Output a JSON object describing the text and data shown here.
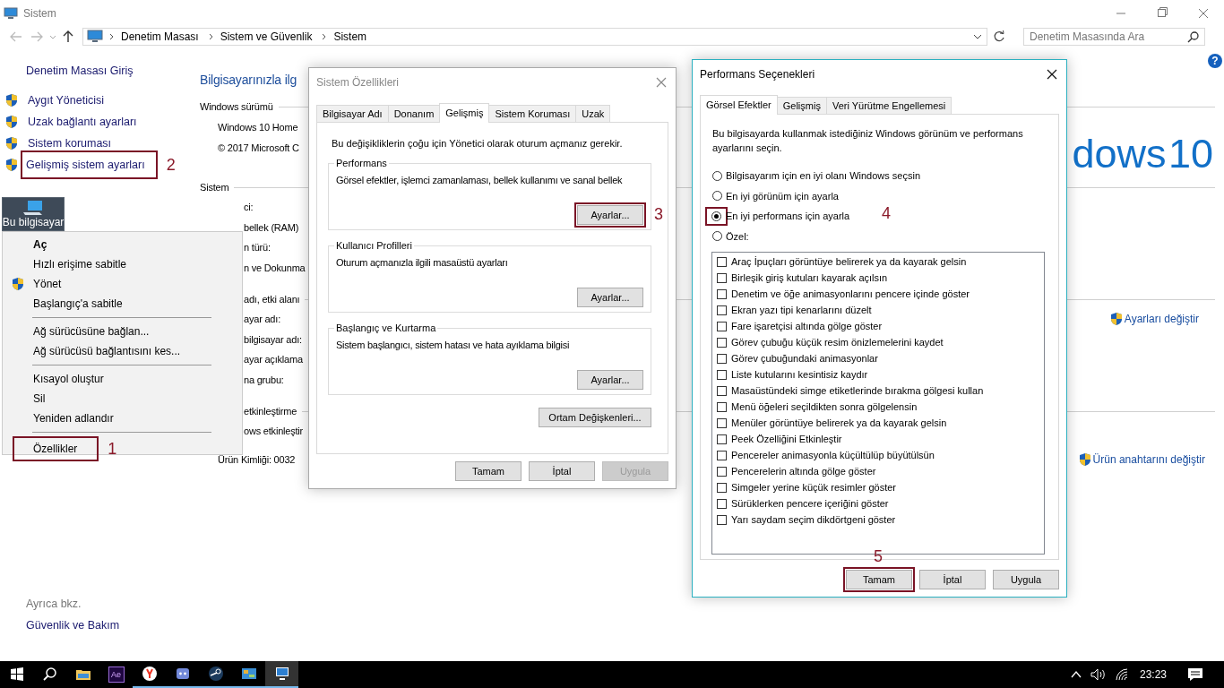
{
  "window": {
    "title": "Sistem",
    "active": false
  },
  "address": {
    "path": [
      "Denetim Masası",
      "Sistem ve Güvenlik",
      "Sistem"
    ],
    "search_placeholder": "Denetim Masasında Ara"
  },
  "sidebar": {
    "home": "Denetim Masası Giriş",
    "links": [
      {
        "label": "Aygıt Yöneticisi"
      },
      {
        "label": "Uzak bağlantı ayarları"
      },
      {
        "label": "Sistem koruması"
      },
      {
        "label": "Gelişmiş sistem ayarları",
        "step": "2"
      }
    ],
    "see_also_title": "Ayrıca bkz.",
    "see_also": [
      "Güvenlik ve Bakım"
    ]
  },
  "main": {
    "heading": "Bilgisayarınızla ilg",
    "help": "?",
    "logo": "dows 10",
    "lines": [
      {
        "kind": "section",
        "text": "Windows sürümü"
      },
      {
        "kind": "value",
        "text": "Windows 10 Home"
      },
      {
        "kind": "value",
        "text": "© 2017 Microsoft C"
      },
      {
        "kind": "section",
        "text": "Sistem"
      },
      {
        "kind": "cut",
        "text": "ci:"
      },
      {
        "kind": "cut",
        "text": "bellek (RAM)"
      },
      {
        "kind": "cut",
        "text": "n türü:"
      },
      {
        "kind": "cut",
        "text": "n ve Dokunma"
      },
      {
        "kind": "cut_section",
        "text": "adı, etki alanı"
      },
      {
        "kind": "cut",
        "text": "ayar adı:",
        "link": "Ayarları değiştir"
      },
      {
        "kind": "cut",
        "text": "bilgisayar adı:"
      },
      {
        "kind": "cut",
        "text": "ayar açıklama"
      },
      {
        "kind": "cut",
        "text": "na grubu:"
      },
      {
        "kind": "cut_section",
        "text": "etkinleştirme"
      },
      {
        "kind": "cut",
        "text": "ows etkinleştir"
      },
      {
        "kind": "value",
        "text": "Ürün Kimliği: 0032",
        "link": "Ürün anahtarını değiştir"
      }
    ]
  },
  "desktop_icon": {
    "label": "Bu bilgisayar",
    "selected": true
  },
  "context_menu": {
    "groups": [
      [
        {
          "label": "Aç",
          "default": true,
          "kind": "plain"
        },
        {
          "label": "Hızlı erişime sabitle",
          "default": false,
          "kind": "plain"
        },
        {
          "label": "Yönet",
          "default": false,
          "kind": "shield"
        },
        {
          "label": "Başlangıç'a sabitle",
          "default": false,
          "kind": "plain"
        }
      ],
      [
        {
          "label": "Ağ sürücüsüne bağlan...",
          "default": false,
          "kind": "plain"
        },
        {
          "label": "Ağ sürücüsü bağlantısını kes...",
          "default": false,
          "kind": "plain"
        }
      ],
      [
        {
          "label": "Kısayol oluştur",
          "default": false,
          "kind": "plain"
        },
        {
          "label": "Sil",
          "default": false,
          "kind": "plain"
        },
        {
          "label": "Yeniden adlandır",
          "default": false,
          "kind": "plain"
        }
      ],
      [
        {
          "label": "Özellikler",
          "default": false,
          "kind": "plain",
          "step": "1"
        }
      ]
    ]
  },
  "system_properties": {
    "title": "Sistem Özellikleri",
    "active": false,
    "tabs": [
      {
        "label": "Bilgisayar Adı",
        "selected": false
      },
      {
        "label": "Donanım",
        "selected": false
      },
      {
        "label": "Gelişmiş",
        "selected": true
      },
      {
        "label": "Sistem Koruması",
        "selected": false
      },
      {
        "label": "Uzak",
        "selected": false
      }
    ],
    "note": "Bu değişikliklerin çoğu için Yönetici olarak oturum açmanız gerekir.",
    "groups": [
      {
        "title": "Performans",
        "text": "Görsel efektler, işlemci zamanlaması, bellek kullanımı ve sanal bellek",
        "button": "Ayarlar...",
        "step": "3"
      },
      {
        "title": "Kullanıcı Profilleri",
        "text": "Oturum açmanızla ilgili masaüstü ayarları",
        "button": "Ayarlar..."
      },
      {
        "title": "Başlangıç ve Kurtarma",
        "text": "Sistem başlangıcı, sistem hatası ve hata ayıklama bilgisi",
        "button": "Ayarlar..."
      }
    ],
    "env_button": "Ortam Değişkenleri...",
    "buttons": [
      {
        "label": "Tamam",
        "disabled": false
      },
      {
        "label": "İptal",
        "disabled": false
      },
      {
        "label": "Uygula",
        "disabled": true
      }
    ]
  },
  "performance_options": {
    "title": "Performans Seçenekleri",
    "active": true,
    "tabs": [
      {
        "label": "Görsel Efektler",
        "selected": true
      },
      {
        "label": "Gelişmiş",
        "selected": false
      },
      {
        "label": "Veri Yürütme Engellemesi",
        "selected": false
      }
    ],
    "description": "Bu bilgisayarda kullanmak istediğiniz Windows görünüm ve performans ayarlarını seçin.",
    "options": [
      {
        "label": "Bilgisayarım için en iyi olanı Windows seçsin",
        "selected": false
      },
      {
        "label": "En iyi görünüm için ayarla",
        "selected": false
      },
      {
        "label": "En iyi performans için ayarla",
        "selected": true,
        "step": "4"
      },
      {
        "label": "Özel:",
        "selected": false
      }
    ],
    "effects": [
      {
        "label": "Araç İpuçları görüntüye belirerek ya da kayarak gelsin",
        "checked": false
      },
      {
        "label": "Birleşik giriş kutuları kayarak açılsın",
        "checked": false
      },
      {
        "label": "Denetim ve öğe animasyonlarını pencere içinde göster",
        "checked": false
      },
      {
        "label": "Ekran yazı tipi kenarlarını düzelt",
        "checked": false
      },
      {
        "label": "Fare işaretçisi altında gölge göster",
        "checked": false
      },
      {
        "label": "Görev çubuğu küçük resim önizlemelerini kaydet",
        "checked": false
      },
      {
        "label": "Görev çubuğundaki animasyonlar",
        "checked": false
      },
      {
        "label": "Liste kutularını kesintisiz kaydır",
        "checked": false
      },
      {
        "label": "Masaüstündeki simge etiketlerinde bırakma gölgesi kullan",
        "checked": false
      },
      {
        "label": "Menü öğeleri seçildikten sonra gölgelensin",
        "checked": false
      },
      {
        "label": "Menüler görüntüye belirerek ya da kayarak gelsin",
        "checked": false
      },
      {
        "label": "Peek Özelliğini Etkinleştir",
        "checked": false
      },
      {
        "label": "Pencereler animasyonla küçültülüp büyütülsün",
        "checked": false
      },
      {
        "label": "Pencerelerin altında gölge göster",
        "checked": false
      },
      {
        "label": "Simgeler yerine küçük resimler göster",
        "checked": false
      },
      {
        "label": "Sürüklerken pencere içeriğini göster",
        "checked": false
      },
      {
        "label": "Yarı saydam seçim dikdörtgeni göster",
        "checked": false
      }
    ],
    "buttons": [
      {
        "label": "Tamam",
        "disabled": false,
        "step": "5"
      },
      {
        "label": "İptal",
        "disabled": false
      },
      {
        "label": "Uygula",
        "disabled": false
      }
    ]
  },
  "taskbar": {
    "apps": [
      {
        "kind": "start",
        "running": false,
        "selected": false
      },
      {
        "kind": "search",
        "running": false,
        "selected": false
      },
      {
        "kind": "explorer",
        "running": false,
        "selected": false
      },
      {
        "kind": "ae",
        "label": "Ae",
        "running": false,
        "selected": false
      },
      {
        "kind": "yandex",
        "running": true,
        "selected": false
      },
      {
        "kind": "discord",
        "running": true,
        "selected": false
      },
      {
        "kind": "steam",
        "running": true,
        "selected": false
      },
      {
        "kind": "app",
        "running": true,
        "selected": false
      },
      {
        "kind": "system",
        "running": true,
        "selected": true
      }
    ],
    "clock": "23:23"
  }
}
